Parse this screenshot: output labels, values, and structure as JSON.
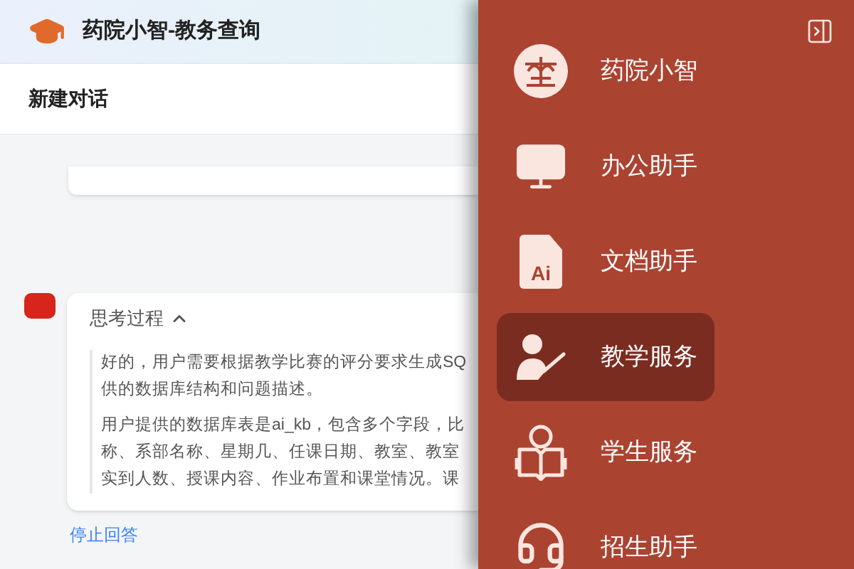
{
  "header": {
    "title": "药院小智-教务查询"
  },
  "conversation": {
    "title": "新建对话"
  },
  "thinking": {
    "label": "思考过程",
    "expanded": true,
    "paragraphs": [
      [
        "好的，用户需要根据教学比赛的评分要求生成SQ",
        "供的数据库结构和问题描述。"
      ],
      [
        "用户提供的数据库表是ai_kb，包含多个字段，比",
        "称、系部名称、星期几、任课日期、教室、教室",
        "实到人数、授课内容、作业布置和课堂情况。课"
      ]
    ]
  },
  "stop_link": "停止回答",
  "drawer": {
    "items": [
      {
        "kind": "logo",
        "label": "药院小智",
        "selected": false
      },
      {
        "kind": "monitor",
        "label": "办公助手",
        "selected": false
      },
      {
        "kind": "file",
        "label": "文档助手",
        "icon_label": "Ai",
        "selected": false
      },
      {
        "kind": "teacher",
        "label": "教学服务",
        "selected": true
      },
      {
        "kind": "reader",
        "label": "学生服务",
        "selected": false
      },
      {
        "kind": "headset",
        "label": "招生助手",
        "selected": false
      }
    ]
  }
}
